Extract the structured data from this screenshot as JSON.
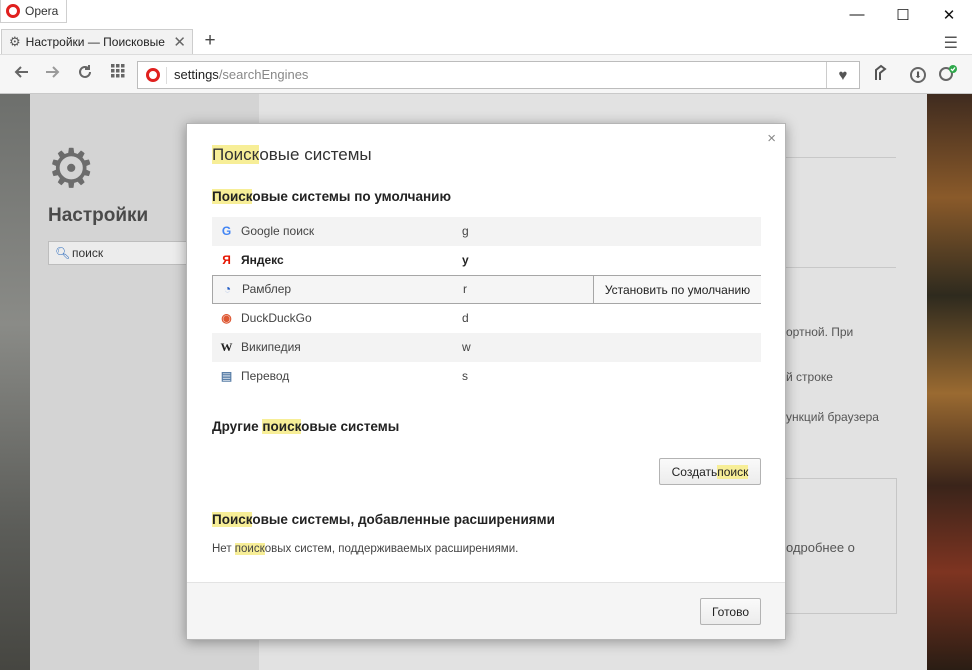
{
  "window": {
    "app_name": "Opera",
    "controls": {
      "minimize": "—",
      "maximize": "☐",
      "close": "✕"
    }
  },
  "tabs": [
    {
      "title": "Настройки — Поисковые системы",
      "close": "✕"
    }
  ],
  "tabbar": {
    "new_tab": "+",
    "menu": "☰"
  },
  "toolbar": {
    "url_host": "settings",
    "url_path": "/searchEngines",
    "heart": "♥"
  },
  "settings_page": {
    "title": "Настройки",
    "search_value": "поиск",
    "bg_texts": [
      "ортной. При",
      "й строке",
      "ункций браузера",
      "одробнее о"
    ]
  },
  "dialog": {
    "title_highlight": "Поиск",
    "title_rest": "овые системы",
    "close": "×",
    "default_section": {
      "highlight": "Поиск",
      "rest": "овые системы по умолчанию"
    },
    "engines": [
      {
        "name": "Google поиск",
        "keyword": "g",
        "icon": "G"
      },
      {
        "name": "Яндекс",
        "keyword": "y",
        "icon": "Я"
      },
      {
        "name": "Рамблер",
        "keyword": "r",
        "icon": "◔"
      },
      {
        "name": "DuckDuckGo",
        "keyword": "d",
        "icon": "◉"
      },
      {
        "name": "Википедия",
        "keyword": "w",
        "icon": "W"
      },
      {
        "name": "Перевод",
        "keyword": "s",
        "icon": "▤"
      }
    ],
    "set_default_label": "Установить по умолчанию",
    "other_section": {
      "pre": "Другие ",
      "highlight": "поиск",
      "rest": "овые системы"
    },
    "create_button": {
      "pre": "Создать ",
      "highlight": "поиск"
    },
    "ext_section": {
      "highlight": "Поиск",
      "rest": "овые системы, добавленные расширениями"
    },
    "ext_note": {
      "pre": "Нет ",
      "highlight": "поиск",
      "rest": "овых систем, поддерживаемых расширениями."
    },
    "done_label": "Готово"
  },
  "colors": {
    "highlight": "#f7ee97",
    "opera_red": "#e0201e",
    "google_blue": "#4285f4",
    "yandex_red": "#e61400",
    "duck_orange": "#de5833"
  }
}
